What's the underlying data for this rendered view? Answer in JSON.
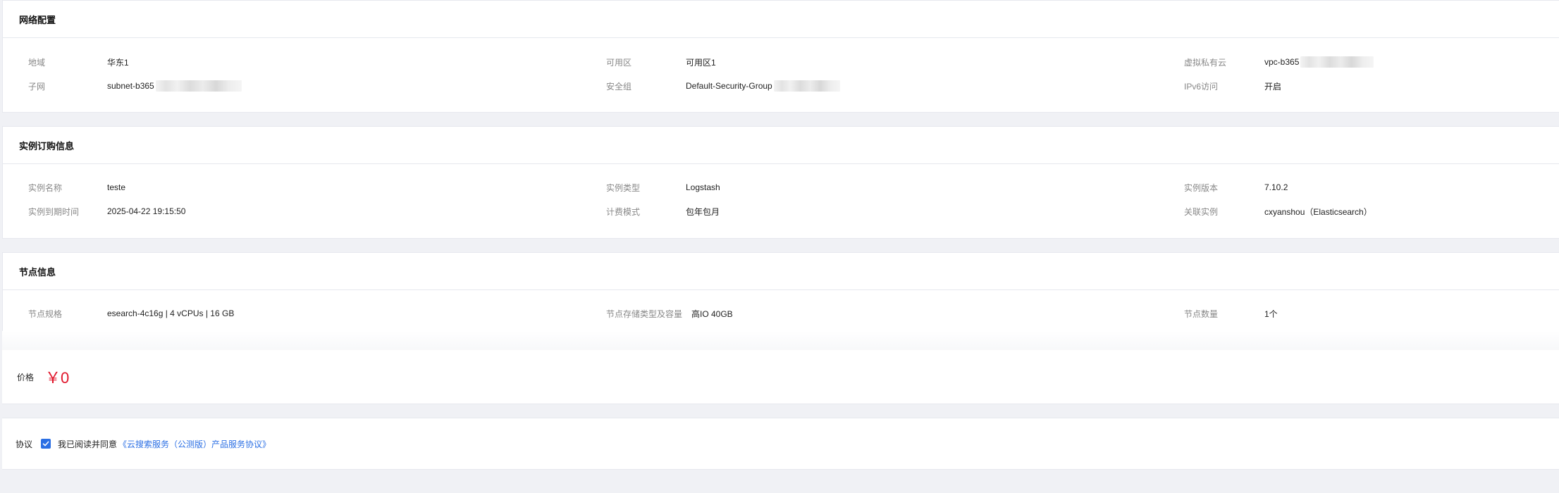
{
  "network": {
    "title": "网络配置",
    "region_label": "地域",
    "region_value": "华东1",
    "zone_label": "可用区",
    "zone_value": "可用区1",
    "vpc_label": "虚拟私有云",
    "vpc_value": "vpc-b365",
    "subnet_label": "子网",
    "subnet_value": "subnet-b365",
    "security_group_label": "安全组",
    "security_group_value": "Default-Security-Group",
    "ipv6_label": "IPv6访问",
    "ipv6_value": "开启"
  },
  "instance": {
    "title": "实例订购信息",
    "name_label": "实例名称",
    "name_value": "teste",
    "type_label": "实例类型",
    "type_value": "Logstash",
    "version_label": "实例版本",
    "version_value": "7.10.2",
    "expire_label": "实例到期时间",
    "expire_value": "2025-04-22 19:15:50",
    "billing_label": "计费模式",
    "billing_value": "包年包月",
    "linked_label": "关联实例",
    "linked_value": "cxyanshou（Elasticsearch）"
  },
  "node": {
    "title": "节点信息",
    "spec_label": "节点规格",
    "spec_value": "esearch-4c16g | 4 vCPUs | 16 GB",
    "storage_label": "节点存储类型及容量",
    "storage_value": "高IO 40GB",
    "count_label": "节点数量",
    "count_value": "1个"
  },
  "price": {
    "label": "价格",
    "value": "￥0",
    "color": "#e0162b"
  },
  "agreement": {
    "label": "协议",
    "checked_text": "我已阅读并同意",
    "link_text": "《云搜索服务（公测版）产品服务协议》",
    "link_color": "#2b6fe4",
    "checkbox_color": "#2b6fe4"
  }
}
